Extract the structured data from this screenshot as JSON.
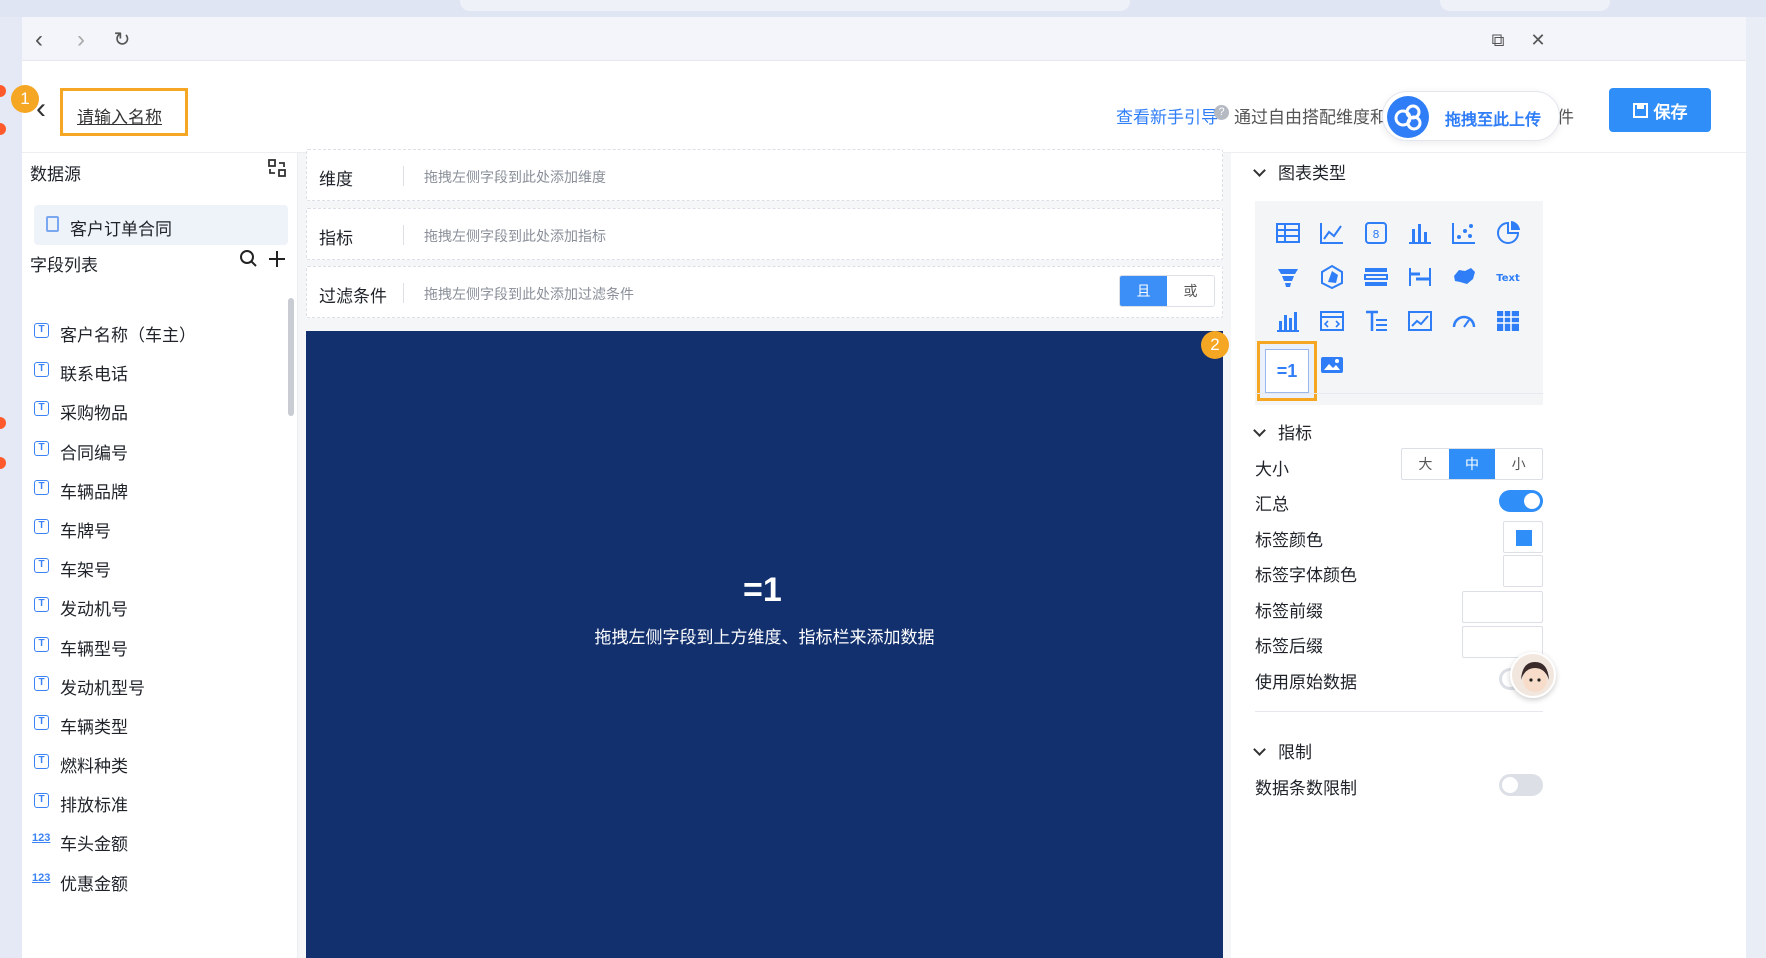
{
  "browser": {
    "back": "‹",
    "forward": "›",
    "reload": "↻",
    "popout": "⧉",
    "close": "✕"
  },
  "header": {
    "name_placeholder": "请输入名称",
    "badge_1": "1",
    "badge_2": "2",
    "guide_link": "查看新手引导",
    "help": "?",
    "description": "通过自由搭配维度和指标形成不同的数据组件",
    "save_label": "保存",
    "upload_label": "拖拽至此上传"
  },
  "left": {
    "datasource_title": "数据源",
    "datasource_item": "客户订单合同",
    "fields_title": "字段列表",
    "fields": [
      {
        "type": "text",
        "label": "客户名称（车主）"
      },
      {
        "type": "text",
        "label": "联系电话"
      },
      {
        "type": "text",
        "label": "采购物品"
      },
      {
        "type": "text",
        "label": "合同编号"
      },
      {
        "type": "text",
        "label": "车辆品牌"
      },
      {
        "type": "text",
        "label": "车牌号"
      },
      {
        "type": "text",
        "label": "车架号"
      },
      {
        "type": "text",
        "label": "发动机号"
      },
      {
        "type": "text",
        "label": "车辆型号"
      },
      {
        "type": "text",
        "label": "发动机型号"
      },
      {
        "type": "text",
        "label": "车辆类型"
      },
      {
        "type": "text",
        "label": "燃料种类"
      },
      {
        "type": "text",
        "label": "排放标准"
      },
      {
        "type": "number",
        "label": "车头金额"
      },
      {
        "type": "number",
        "label": "优惠金额"
      }
    ],
    "text_icon": "T",
    "number_icon": "123"
  },
  "center": {
    "dimension_label": "维度",
    "dimension_hint": "拖拽左侧字段到此处添加维度",
    "metric_label": "指标",
    "metric_hint": "拖拽左侧字段到此处添加指标",
    "filter_label": "过滤条件",
    "filter_hint": "拖拽左侧字段到此处添加过滤条件",
    "filter_and": "且",
    "filter_or": "或",
    "canvas_icon": "=1",
    "canvas_hint": "拖拽左侧字段到上方维度、指标栏来添加数据"
  },
  "right": {
    "chart_type_title": "图表类型",
    "metric_title": "指标",
    "size_label": "大小",
    "size_options": [
      "大",
      "中",
      "小"
    ],
    "size_selected": "中",
    "summary_label": "汇总",
    "summary_on": true,
    "label_color_label": "标签颜色",
    "label_color_value": "#2f8ef7",
    "label_font_color_label": "标签字体颜色",
    "label_prefix_label": "标签前缀",
    "label_suffix_label": "标签后缀",
    "use_raw_label": "使用原始数据",
    "use_raw_on": false,
    "limit_title": "限制",
    "limit_label": "数据条数限制",
    "limit_on": false
  },
  "colors": {
    "accent": "#2f8ef7",
    "highlight": "#f5a623",
    "canvas": "#13306e"
  }
}
